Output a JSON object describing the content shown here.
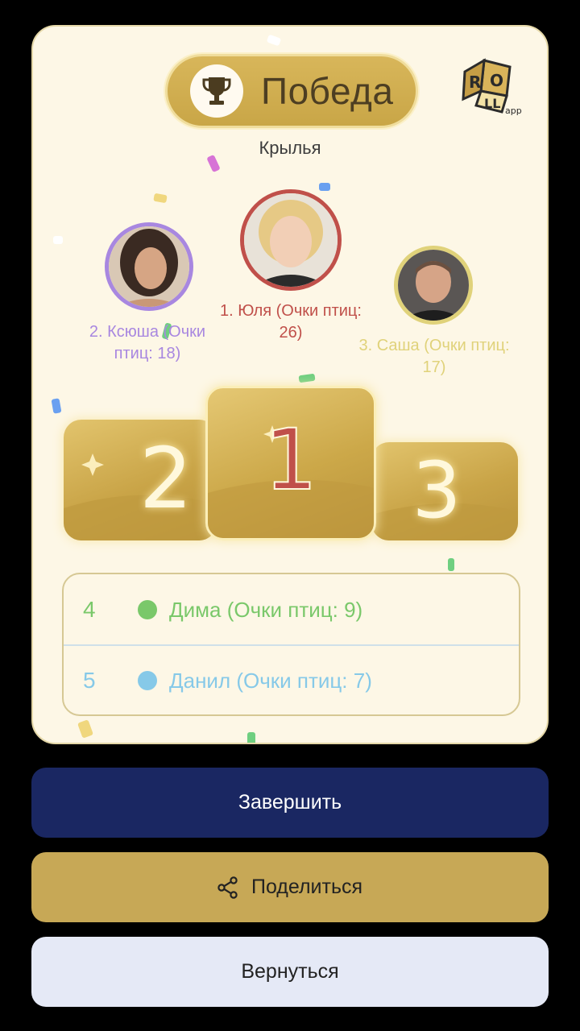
{
  "header": {
    "title": "Победа",
    "subtitle": "Крылья",
    "logo_text": "ROLL",
    "logo_sub": "app"
  },
  "podium": {
    "first": {
      "rank": "1",
      "label": "1. Юля (Очки птиц: 26)",
      "color": "#c0504a"
    },
    "second": {
      "rank": "2",
      "label": "2. Ксюша (Очки птиц: 18)",
      "color": "#a887e0"
    },
    "third": {
      "rank": "3",
      "label": "3. Саша (Очки птиц: 17)",
      "color": "#e0d27a"
    }
  },
  "others": [
    {
      "rank": "4",
      "name": "Дима (Очки птиц: 9)",
      "color": "#7ac86a"
    },
    {
      "rank": "5",
      "name": "Данил (Очки птиц: 7)",
      "color": "#86c9e8"
    }
  ],
  "buttons": {
    "finish": "Завершить",
    "share": "Поделиться",
    "back": "Вернуться"
  },
  "colors": {
    "card_bg": "#fdf7e6",
    "gold": "#c9a647",
    "finish_bg": "#1a2762",
    "back_bg": "#e5e9f6"
  }
}
